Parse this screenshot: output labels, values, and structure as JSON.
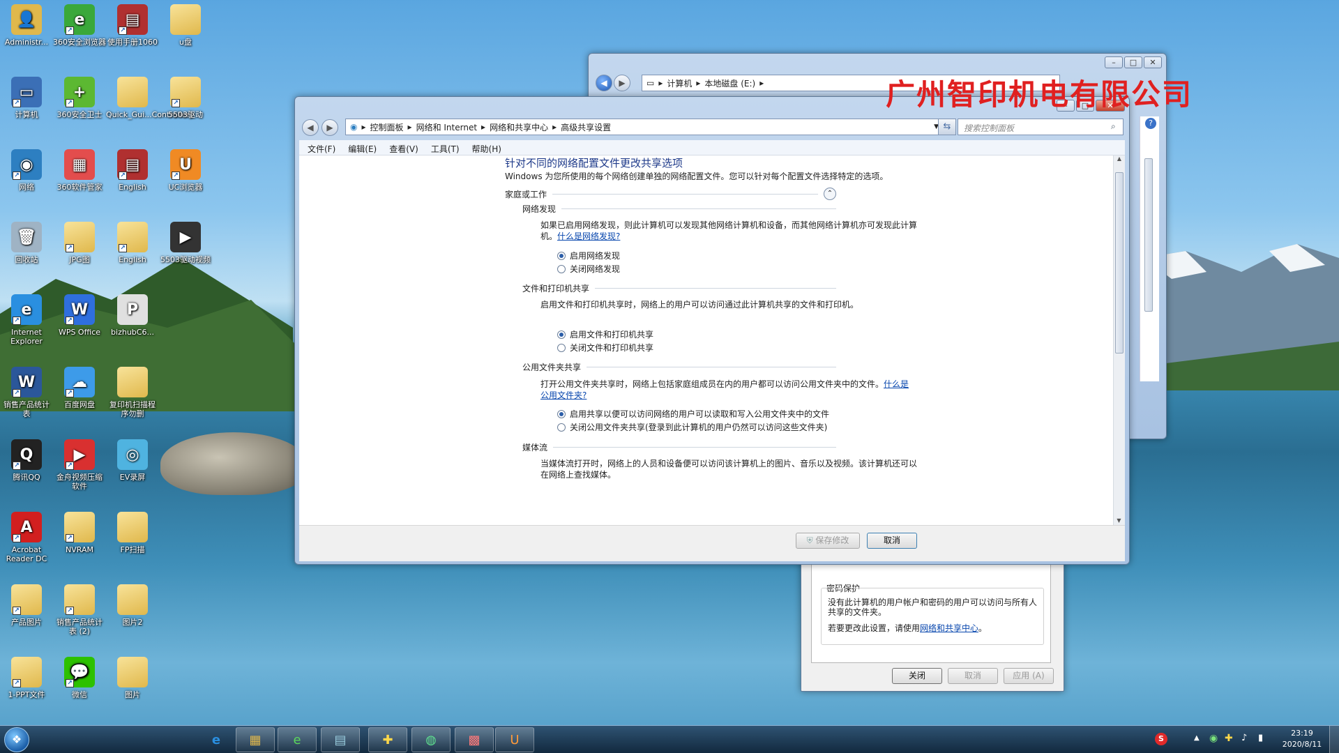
{
  "desktop": {
    "icons": [
      {
        "label": "Administr...",
        "col": 0,
        "row": 0,
        "kind": "user",
        "color": "#e0b84c",
        "glyph": "👤"
      },
      {
        "label": "360安全浏览器",
        "col": 1,
        "row": 0,
        "kind": "app",
        "color": "#3aa83a",
        "glyph": "e"
      },
      {
        "label": "使用手册1060",
        "col": 2,
        "row": 0,
        "kind": "app",
        "color": "#b03030",
        "glyph": "▤"
      },
      {
        "label": "u盘",
        "col": 3,
        "row": 0,
        "kind": "folder",
        "color": "#e0b84c",
        "glyph": ""
      },
      {
        "label": "计算机",
        "col": 0,
        "row": 1,
        "kind": "app",
        "color": "#3b6fb6",
        "glyph": "▭"
      },
      {
        "label": "360安全卫士",
        "col": 1,
        "row": 1,
        "kind": "app",
        "color": "#5cb832",
        "glyph": "+"
      },
      {
        "label": "Quick_Gui...Controller)",
        "col": 2,
        "row": 1,
        "kind": "folder",
        "color": "#e0b84c",
        "glyph": ""
      },
      {
        "label": "5503驱动",
        "col": 3,
        "row": 1,
        "kind": "folder",
        "color": "#e0b84c",
        "glyph": ""
      },
      {
        "label": "网络",
        "col": 0,
        "row": 2,
        "kind": "app",
        "color": "#2d7fc1",
        "glyph": "◉"
      },
      {
        "label": "360软件管家",
        "col": 1,
        "row": 2,
        "kind": "app",
        "color": "#e34d4d",
        "glyph": "▦"
      },
      {
        "label": "English",
        "col": 2,
        "row": 2,
        "kind": "app",
        "color": "#b03030",
        "glyph": "▤"
      },
      {
        "label": "UC浏览器",
        "col": 3,
        "row": 2,
        "kind": "app",
        "color": "#f08a24",
        "glyph": "U"
      },
      {
        "label": "回收站",
        "col": 0,
        "row": 3,
        "kind": "app",
        "color": "#9fb3c4",
        "glyph": "🗑"
      },
      {
        "label": "JPG图",
        "col": 1,
        "row": 3,
        "kind": "folder",
        "color": "#e0b84c",
        "glyph": ""
      },
      {
        "label": "English",
        "col": 2,
        "row": 3,
        "kind": "folder",
        "color": "#e0b84c",
        "glyph": ""
      },
      {
        "label": "5503驱动视频",
        "col": 3,
        "row": 3,
        "kind": "app",
        "color": "#333",
        "glyph": "▶"
      },
      {
        "label": "Internet Explorer",
        "col": 0,
        "row": 4,
        "kind": "app",
        "color": "#2a8fe0",
        "glyph": "e"
      },
      {
        "label": "WPS Office",
        "col": 1,
        "row": 4,
        "kind": "app",
        "color": "#2f6fde",
        "glyph": "W"
      },
      {
        "label": "bizhubC6...",
        "col": 2,
        "row": 4,
        "kind": "app",
        "color": "#e0e0e0",
        "glyph": "P"
      },
      {
        "label": "销售产品统计表",
        "col": 0,
        "row": 5,
        "kind": "app",
        "color": "#2b579a",
        "glyph": "W"
      },
      {
        "label": "百度网盘",
        "col": 1,
        "row": 5,
        "kind": "app",
        "color": "#3d9be9",
        "glyph": "☁"
      },
      {
        "label": "复印机扫描程序勿删",
        "col": 2,
        "row": 5,
        "kind": "folder",
        "color": "#e0b84c",
        "glyph": ""
      },
      {
        "label": "腾讯QQ",
        "col": 0,
        "row": 6,
        "kind": "app",
        "color": "#222",
        "glyph": "Q"
      },
      {
        "label": "金舟视频压缩软件",
        "col": 1,
        "row": 6,
        "kind": "app",
        "color": "#d93030",
        "glyph": "▶"
      },
      {
        "label": "EV录屏",
        "col": 2,
        "row": 6,
        "kind": "app",
        "color": "#4fb3e0",
        "glyph": "◎"
      },
      {
        "label": "Acrobat Reader DC",
        "col": 0,
        "row": 7,
        "kind": "app",
        "color": "#d21f1f",
        "glyph": "A"
      },
      {
        "label": "NVRAM",
        "col": 1,
        "row": 7,
        "kind": "folder",
        "color": "#e0b84c",
        "glyph": ""
      },
      {
        "label": "FP扫描",
        "col": 2,
        "row": 7,
        "kind": "folder",
        "color": "#e0b84c",
        "glyph": ""
      },
      {
        "label": "产品图片",
        "col": 0,
        "row": 8,
        "kind": "folder",
        "color": "#e0b84c",
        "glyph": ""
      },
      {
        "label": "销售产品统计表 (2)",
        "col": 1,
        "row": 8,
        "kind": "folder",
        "color": "#e0b84c",
        "glyph": ""
      },
      {
        "label": "图片2",
        "col": 2,
        "row": 8,
        "kind": "folder",
        "color": "#e0b84c",
        "glyph": ""
      },
      {
        "label": "1-PPT文件",
        "col": 0,
        "row": 9,
        "kind": "folder",
        "color": "#e0b84c",
        "glyph": ""
      },
      {
        "label": "微信",
        "col": 1,
        "row": 9,
        "kind": "app",
        "color": "#2dc100",
        "glyph": "💬"
      },
      {
        "label": "图片",
        "col": 2,
        "row": 9,
        "kind": "folder",
        "color": "#e0b84c",
        "glyph": ""
      }
    ]
  },
  "watermark": {
    "text": "广州智印机电有限公司",
    "color": "#e02020"
  },
  "explorer_window": {
    "breadcrumb": [
      "计算机",
      "本地磁盘 (E:)"
    ]
  },
  "properties_window": {
    "section_title": "密码保护",
    "desc": "没有此计算机的用户帐户和密码的用户可以访问与所有人共享的文件夹。",
    "change_text": "若要更改此设置，请使用",
    "change_link": "网络和共享中心",
    "change_suffix": "。",
    "buttons": {
      "close": "关闭",
      "cancel": "取消",
      "apply": "应用 (A)"
    }
  },
  "main_window": {
    "breadcrumb": [
      "控制面板",
      "网络和 Internet",
      "网络和共享中心",
      "高级共享设置"
    ],
    "search_placeholder": "搜索控制面板",
    "menu": [
      "文件(F)",
      "编辑(E)",
      "查看(V)",
      "工具(T)",
      "帮助(H)"
    ],
    "heading": "针对不同的网络配置文件更改共享选项",
    "intro": "Windows 为您所使用的每个网络创建单独的网络配置文件。您可以针对每个配置文件选择特定的选项。",
    "profile": "家庭或工作",
    "sections": {
      "discovery": {
        "title": "网络发现",
        "desc": "如果已启用网络发现，则此计算机可以发现其他网络计算机和设备，而其他网络计算机亦可发现此计算机。",
        "link": "什么是网络发现?",
        "opt_on": "启用网络发现",
        "opt_off": "关闭网络发现"
      },
      "file_print": {
        "title": "文件和打印机共享",
        "desc": "启用文件和打印机共享时，网络上的用户可以访问通过此计算机共享的文件和打印机。",
        "opt_on": "启用文件和打印机共享",
        "opt_off": "关闭文件和打印机共享"
      },
      "public": {
        "title": "公用文件夹共享",
        "desc": "打开公用文件夹共享时，网络上包括家庭组成员在内的用户都可以访问公用文件夹中的文件。",
        "link": "什么是公用文件夹?",
        "opt_on": "启用共享以便可以访问网络的用户可以读取和写入公用文件夹中的文件",
        "opt_off": "关闭公用文件夹共享(登录到此计算机的用户仍然可以访问这些文件夹)"
      },
      "media": {
        "title": "媒体流",
        "desc": "当媒体流打开时，网络上的人员和设备便可以访问该计算机上的图片、音乐以及视频。该计算机还可以在网络上查找媒体。"
      }
    },
    "buttons": {
      "save": "保存修改",
      "cancel": "取消"
    }
  },
  "tray": {
    "time": "23:19",
    "date": "2020/8/11"
  }
}
